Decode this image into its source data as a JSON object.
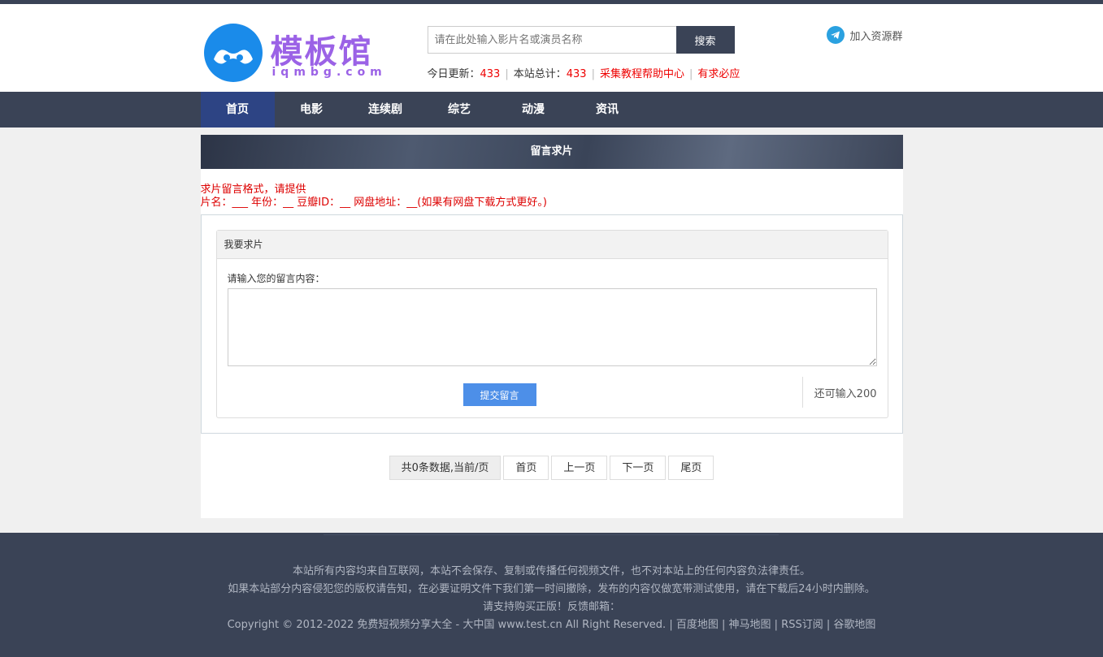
{
  "logo": {
    "text": "模板馆",
    "sub": "iqmbg.com"
  },
  "search": {
    "placeholder": "请在此处输入影片名或演员名称",
    "button": "搜索"
  },
  "stats": {
    "today_label": "今日更新：",
    "today_value": "433",
    "total_label": "本站总计：",
    "total_value": "433",
    "help_link": "采集教程帮助中心",
    "request_link": "有求必应"
  },
  "join": {
    "label": "加入资源群",
    "icon": "telegram-icon"
  },
  "nav": [
    "首页",
    "电影",
    "连续剧",
    "综艺",
    "动漫",
    "资讯"
  ],
  "banner": {
    "title": "留言求片"
  },
  "notice": {
    "line1": "求片留言格式，请提供",
    "line2": "片名：___ 年份：__ 豆瓣ID：__ 网盘地址：__(如果有网盘下载方式更好。)"
  },
  "form": {
    "panel_title": "我要求片",
    "label": "请输入您的留言内容：",
    "submit": "提交留言",
    "remain": "还可输入200"
  },
  "pager": {
    "info": "共0条数据,当前/页",
    "first": "首页",
    "prev": "上一页",
    "next": "下一页",
    "last": "尾页"
  },
  "footer": {
    "line1": "本站所有内容均来自互联网，本站不会保存、复制或传播任何视频文件，也不对本站上的任何内容负法律责任。",
    "line2": "如果本站部分内容侵犯您的版权请告知，在必要证明文件下我们第一时间撤除，发布的内容仅做宽带测试使用，请在下载后24小时内删除。",
    "line3": "请支持购买正版！反馈邮箱：",
    "copyright": "Copyright © 2012-2022 免费短视频分享大全 - 大中国  www.test.cn   All Right Reserved.",
    "links": [
      "百度地图",
      "神马地图",
      "RSS订阅",
      "谷歌地图"
    ]
  },
  "colors": {
    "dark": "#3a4356",
    "accent": "#2d4484",
    "red": "#e00000",
    "button": "#4d8fe8"
  }
}
